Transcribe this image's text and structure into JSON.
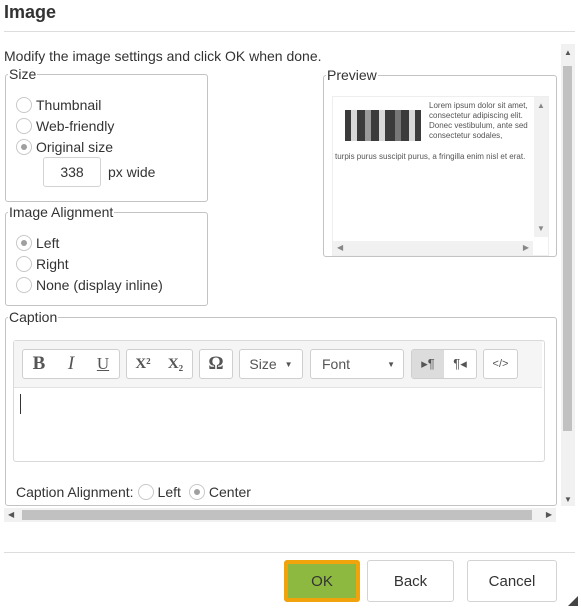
{
  "dialog": {
    "title": "Image"
  },
  "intro": "Modify the image settings and click OK when done.",
  "size": {
    "legend": "Size",
    "options": [
      "Thumbnail",
      "Web-friendly",
      "Original size"
    ],
    "selected": "Original size",
    "width_value": "338",
    "width_unit": "px wide"
  },
  "alignment": {
    "legend": "Image Alignment",
    "options": [
      "Left",
      "Right",
      "None (display inline)"
    ],
    "selected": "Left"
  },
  "preview": {
    "legend": "Preview",
    "text_beside": "Lorem ipsum dolor sit amet, consectetur adipiscing elit. Donec vestibulum, ante sed consectetur sodales,",
    "text_below": "turpis purus suscipit purus, a fringilla enim nisl et erat."
  },
  "caption": {
    "legend": "Caption",
    "toolbar": {
      "bold": "B",
      "italic": "I",
      "underline": "U",
      "superscript": "X²",
      "subscript": "X₂",
      "special_char": "Ω",
      "size_label": "Size",
      "font_label": "Font",
      "ltr": "▸¶",
      "rtl": "¶◂",
      "source": "</>"
    },
    "value": "",
    "alignment_label": "Caption Alignment:",
    "alignment_options": [
      "Left",
      "Center"
    ],
    "alignment_selected": "Center"
  },
  "buttons": {
    "ok": "OK",
    "back": "Back",
    "cancel": "Cancel"
  },
  "colors": {
    "ok_background": "#8db940",
    "ok_focus_border": "#f0a30a"
  }
}
